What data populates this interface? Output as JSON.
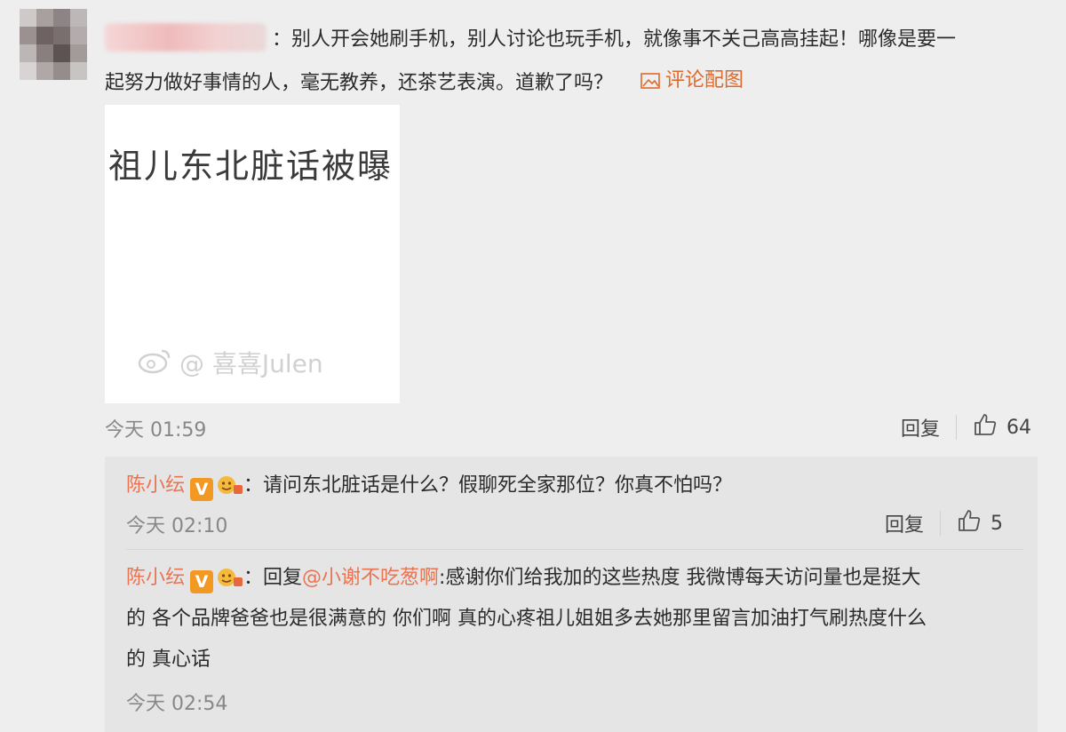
{
  "main_comment": {
    "text_line1": "：别人开会她刷手机，别人讨论也玩手机，就像事不关己高高挂起！哪像是要一",
    "text_line2": "起努力做好事情的人，毫无教养，还茶艺表演。道歉了吗？",
    "image_link_label": "评论配图",
    "attached_image": {
      "text": "祖儿东北脏话被曝",
      "watermark": "@ 喜喜Julen"
    },
    "timestamp": "今天 01:59",
    "reply_label": "回复",
    "like_count": "64"
  },
  "replies": [
    {
      "username": "陈小纭",
      "v_badge": "V",
      "text": "：请问东北脏话是什么？假聊死全家那位？你真不怕吗？",
      "timestamp": "今天 02:10",
      "reply_label": "回复",
      "like_count": "5"
    },
    {
      "username": "陈小纭",
      "v_badge": "V",
      "text_prefix": "：回复",
      "mention": "@小谢不吃葱啊",
      "text_line1": ":感谢你们给我加的这些热度 我微博每天访问量也是挺大",
      "text_line2": "的 各个品牌爸爸也是很满意的 你们啊 真的心疼祖儿姐姐多去她那里留言加油打气刷热度什么",
      "text_line3": "的 真心话",
      "timestamp": "今天 02:54"
    }
  ],
  "colors": {
    "accent": "#eb7350",
    "link": "#e06a2c",
    "v_badge": "#f29924",
    "page_bg": "#eeeeee",
    "reply_bg": "#e5e5e5"
  },
  "icons": [
    "image-icon",
    "thumbs-up-icon",
    "weibo-logo-icon",
    "verified-v-icon",
    "fan-badge-icon"
  ]
}
